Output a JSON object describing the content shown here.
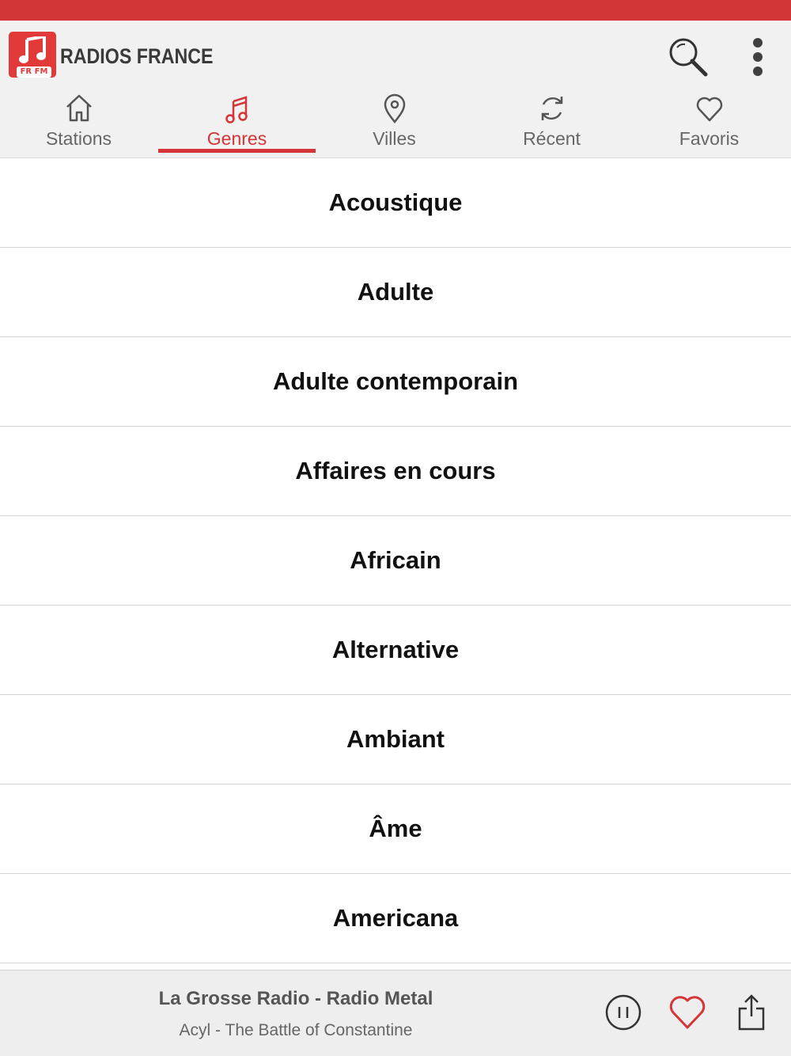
{
  "colors": {
    "accent": "#d43537",
    "header_bg": "#f1f1f1",
    "tab_inactive": "#666666",
    "list_text": "#111111",
    "player_bg": "#eeeeee"
  },
  "app": {
    "title": "RADIOS FRANCE",
    "logo_badge": "FR FM",
    "logo_icon": "music-note-icon"
  },
  "header_actions": {
    "search_icon": "search-icon",
    "more_icon": "more-vertical-icon"
  },
  "tabs": [
    {
      "label": "Stations",
      "icon": "home-icon",
      "active": false
    },
    {
      "label": "Genres",
      "icon": "music-note-icon",
      "active": true
    },
    {
      "label": "Villes",
      "icon": "location-pin-icon",
      "active": false
    },
    {
      "label": "Récent",
      "icon": "refresh-icon",
      "active": false
    },
    {
      "label": "Favoris",
      "icon": "heart-icon",
      "active": false
    }
  ],
  "genres": [
    "Acoustique",
    "Adulte",
    "Adulte contemporain",
    "Affaires en cours",
    "Africain",
    "Alternative",
    "Ambiant",
    "Âme",
    "Americana"
  ],
  "player": {
    "station": "La Grosse Radio - Radio Metal",
    "track": "Acyl - The Battle of Constantine",
    "pause_icon": "pause-icon",
    "favorite_icon": "heart-icon",
    "share_icon": "share-icon"
  }
}
